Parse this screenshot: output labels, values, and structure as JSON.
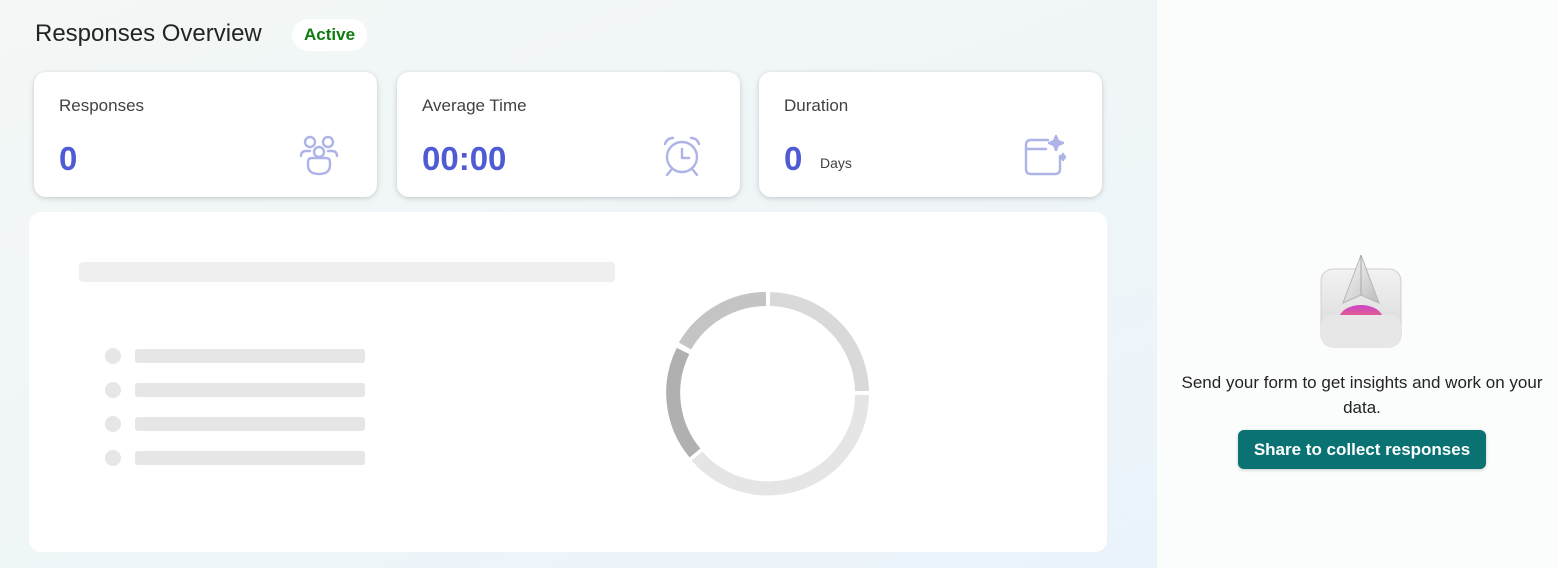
{
  "header": {
    "title": "Responses Overview",
    "status": "Active"
  },
  "cards": [
    {
      "label": "Responses",
      "value": "0",
      "icon": "people-group-icon"
    },
    {
      "label": "Average Time",
      "value": "00:00",
      "icon": "alarm-clock-icon"
    },
    {
      "label": "Duration",
      "value": "0",
      "unit": "Days",
      "icon": "calendar-sparkle-icon"
    }
  ],
  "empty_state": {
    "message": "Send your form to get insights and work on your data.",
    "button_label": "Share to collect responses",
    "illustration": "paper-plane-tray-icon"
  },
  "colors": {
    "accent_value": "#4f5bd5",
    "status_green": "#107c10",
    "button_teal": "#0a7272",
    "icon_stroke": "#aeb3e8"
  }
}
